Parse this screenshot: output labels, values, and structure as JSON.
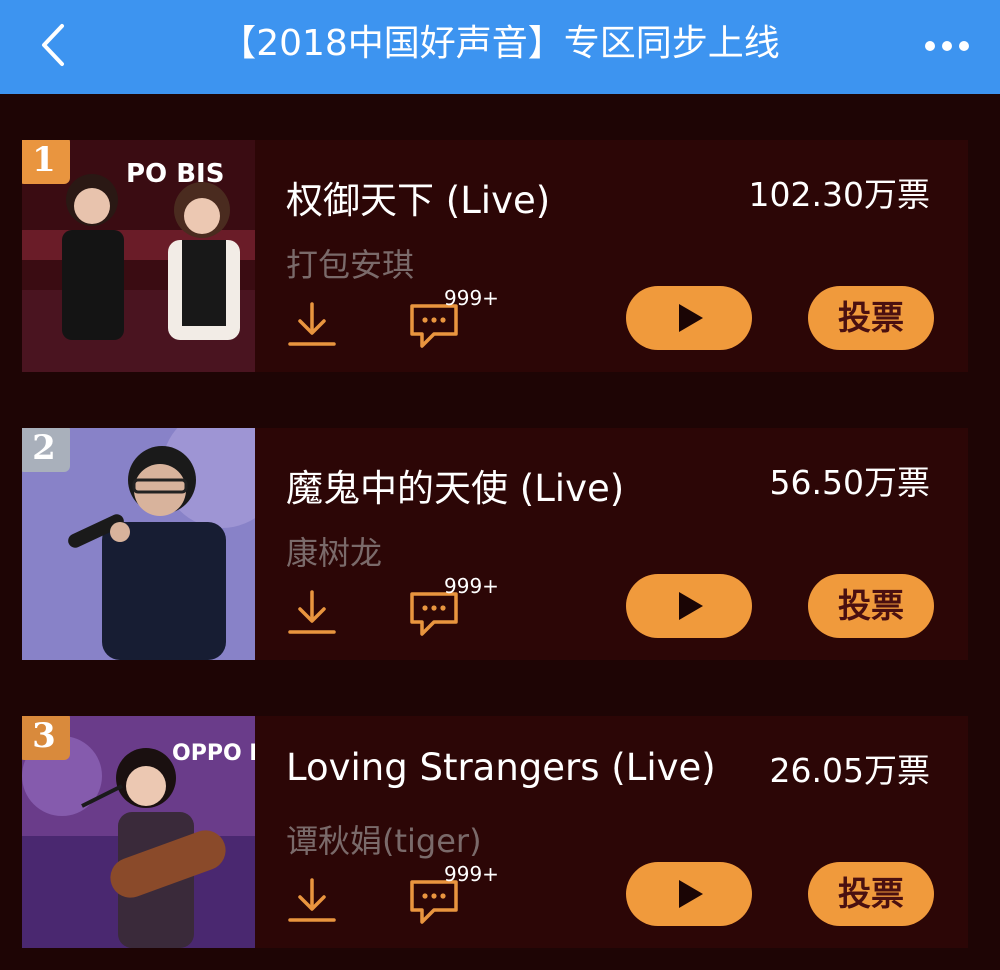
{
  "header": {
    "title": "【2018中国好声音】专区同步上线",
    "back_icon": "chevron-left-icon",
    "more_icon": "more-dots-icon",
    "background_color": "#3d94f0"
  },
  "songs": [
    {
      "rank": "1",
      "rank_color": "#e9953f",
      "title": "权御天下 (Live)",
      "artist": "打包安琪",
      "votes": "102.30万票",
      "comment_count": "999+",
      "vote_label": "投票"
    },
    {
      "rank": "2",
      "rank_color": "#a9b0bb",
      "title": "魔鬼中的天使 (Live)",
      "artist": "康树龙",
      "votes": "56.50万票",
      "comment_count": "999+",
      "vote_label": "投票"
    },
    {
      "rank": "3",
      "rank_color": "#d98a3c",
      "title": "Loving Strangers (Live)",
      "artist": "谭秋娟(tiger)",
      "votes": "26.05万票",
      "comment_count": "999+",
      "vote_label": "投票"
    }
  ],
  "colors": {
    "accent": "#f09a3c",
    "card_background": "#2c0606",
    "page_background": "#1e0505"
  }
}
